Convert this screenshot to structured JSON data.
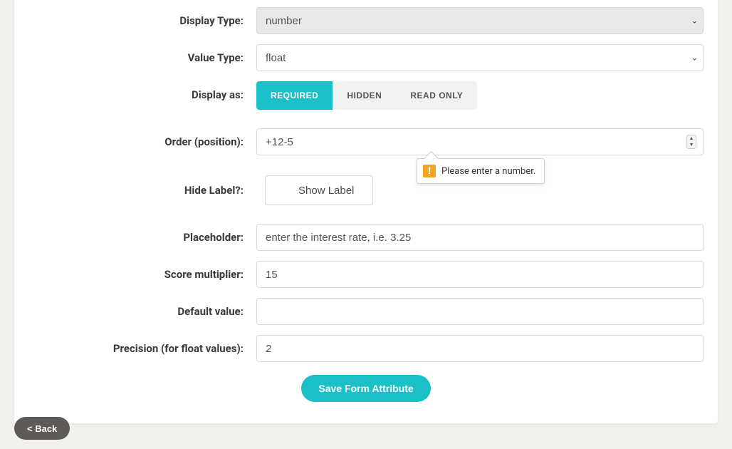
{
  "fields": {
    "display_type": {
      "label": "Display Type:",
      "value": "number"
    },
    "value_type": {
      "label": "Value Type:",
      "value": "float"
    },
    "display_as": {
      "label": "Display as:",
      "options": {
        "required": "REQUIRED",
        "hidden": "HIDDEN",
        "read_only": "READ ONLY"
      },
      "active": "required"
    },
    "order": {
      "label": "Order (position):",
      "value": "+12-5",
      "validation_message": "Please enter a number."
    },
    "hide_label": {
      "label": "Hide Label?:",
      "button": "Show Label"
    },
    "placeholder": {
      "label": "Placeholder:",
      "value": "enter the interest rate, i.e. 3.25"
    },
    "score_multiplier": {
      "label": "Score multiplier:",
      "value": "15"
    },
    "default_value": {
      "label": "Default value:",
      "value": ""
    },
    "precision": {
      "label": "Precision (for float values):",
      "value": "2"
    }
  },
  "buttons": {
    "save": "Save Form Attribute",
    "back": "< Back"
  }
}
